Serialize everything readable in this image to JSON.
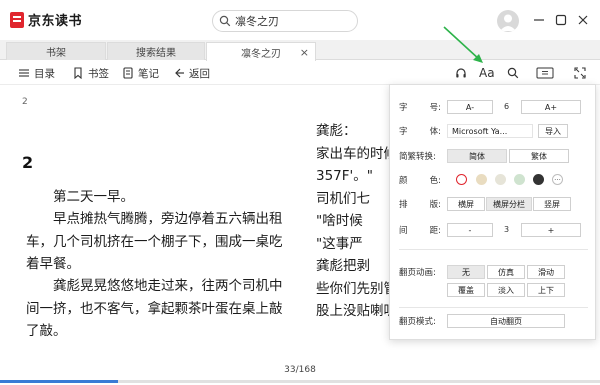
{
  "app": {
    "name": "京东读书",
    "brand_color": "#e0262e"
  },
  "search": {
    "value": "凛冬之刃"
  },
  "tabs": [
    {
      "label": "书架"
    },
    {
      "label": "搜索结果"
    },
    {
      "label": "凛冬之刃",
      "close": "×"
    }
  ],
  "toolbar": {
    "catalog": "目录",
    "bookmark": "书签",
    "notes": "笔记",
    "back": "返回",
    "font_icon_text": "Aa"
  },
  "reader": {
    "page_top_number": "2",
    "chapter_number": "2",
    "paragraphs": [
      "第二天一早。",
      "早点摊热气腾腾，旁边停着五六辆出租车，几个司机挤在一个棚子下，围成一桌吃着早餐。",
      "龚彪晃晃悠悠地走过来，往两个司机中间一挤，也不客气，拿起颗茶叶蛋在桌上敲了敲。"
    ],
    "column2_lines": [
      "    龚彪：",
      "家出车的时候",
      "357F'。\"",
      "    司机们七",
      "    \"啥时候",
      "    \"这事严",
      "    龚彪把剥",
      "些你们先别管",
      "股上没贴喇叭"
    ]
  },
  "progress": {
    "label": "33/168",
    "current": 33,
    "total": 168
  },
  "settings": {
    "font_size": {
      "label_a": "字",
      "label_b": "号:",
      "decrease": "A-",
      "value": "6",
      "increase": "A+"
    },
    "font_face": {
      "label_a": "字",
      "label_b": "体:",
      "value": "Microsoft Ya...",
      "import": "导入"
    },
    "conversion": {
      "label": "简繁转换:",
      "simplified": "简体",
      "traditional": "繁体"
    },
    "colors": {
      "label_a": "颜",
      "label_b": "色:",
      "swatches": [
        "#ffffff",
        "#e9dcc0",
        "#e6e4d8",
        "#cfe3cf",
        "#333333"
      ],
      "more": "···"
    },
    "layout": {
      "label_a": "排",
      "label_b": "版:",
      "landscape": "横屏",
      "landscape_split": "横屏分栏",
      "portrait": "竖屏"
    },
    "spacing": {
      "label_a": "间",
      "label_b": "距:",
      "decrease": "-",
      "value": "3",
      "increase": "+"
    },
    "page_animation": {
      "label": "翻页动画:",
      "none": "无",
      "simulate": "仿真",
      "slide": "滑动",
      "cover": "覆盖",
      "fade": "淡入",
      "updown": "上下"
    },
    "page_mode": {
      "label": "翻页模式:",
      "auto": "自动翻页"
    }
  }
}
